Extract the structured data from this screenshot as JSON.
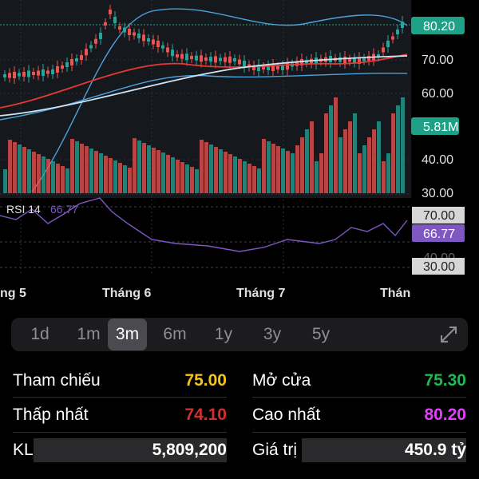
{
  "chart": {
    "price_axis_ticks": [
      "70.00",
      "60.00",
      "40.00",
      "30.00"
    ],
    "price_badge": "80.20",
    "volume_badge": "5.81M",
    "rsi_label": "RSI 14",
    "rsi_value": "66.77",
    "rsi_ticks": [
      "70.00",
      "30.00"
    ],
    "rsi_hidden_tick": "40.00",
    "month_labels": [
      "ng 5",
      "Tháng 6",
      "Tháng 7",
      "Thán"
    ],
    "colors": {
      "up": "#26a69a",
      "down": "#ef5350",
      "ma_red": "#e53935",
      "ma_light": "#cfe3f0",
      "band": "#4aa3df",
      "rsi_line": "#7e57c2",
      "badge_green": "#1fa187",
      "badge_purple": "#7e57c2"
    }
  },
  "timeframes": {
    "items": [
      "1d",
      "1m",
      "3m",
      "6m",
      "1y",
      "3y",
      "5y"
    ],
    "selected": "3m"
  },
  "stats": {
    "left": [
      {
        "label": "Tham chiếu",
        "value": "75.00",
        "color": "#f5c518"
      },
      {
        "label": "Thấp nhất",
        "value": "74.10",
        "color": "#d32f2f"
      },
      {
        "label": "KL",
        "value": "5,809,200",
        "color": "#ffffff"
      }
    ],
    "right": [
      {
        "label": "Mở cửa",
        "value": "75.30",
        "color": "#1db954"
      },
      {
        "label": "Cao nhất",
        "value": "80.20",
        "color": "#e040fb"
      },
      {
        "label": "Giá trị",
        "value": "450.9 tỷ",
        "color": "#ffffff"
      }
    ]
  }
}
